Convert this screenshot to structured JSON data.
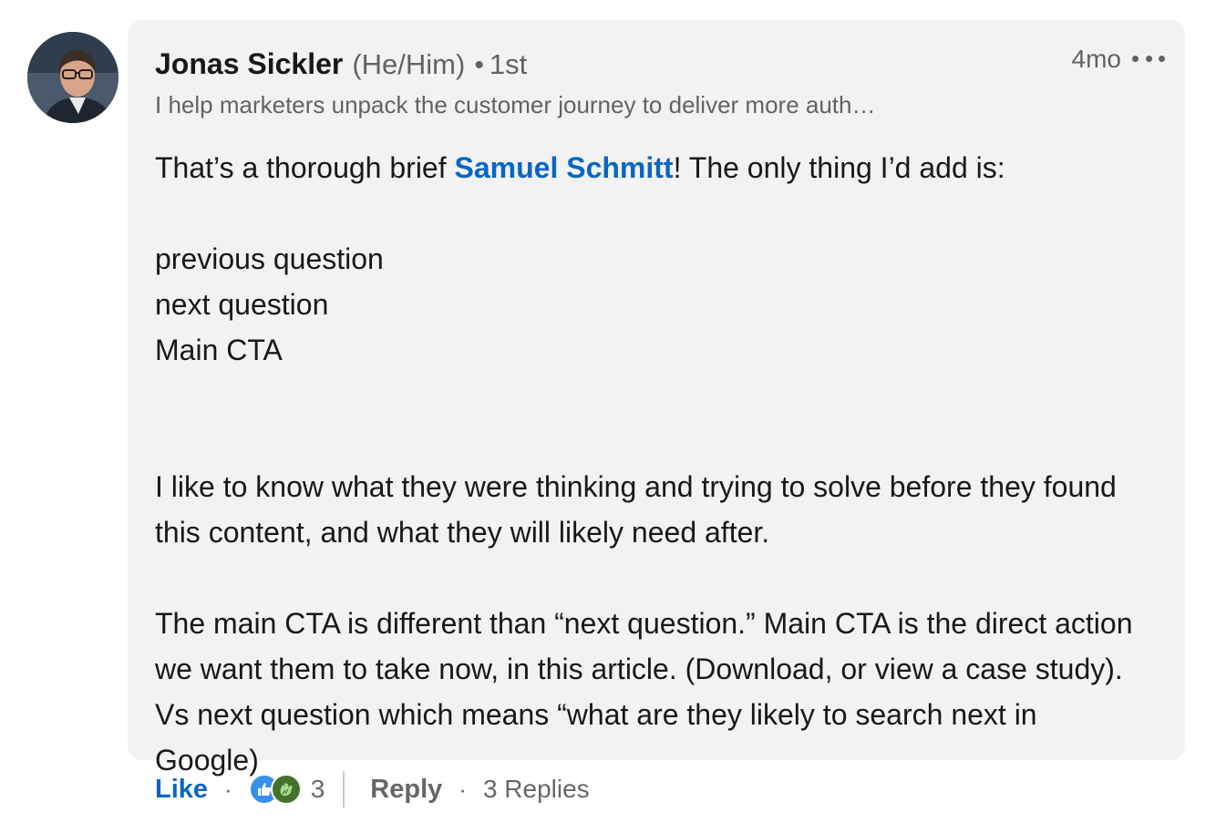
{
  "comment": {
    "author": {
      "name": "Jonas Sickler",
      "pronouns": "(He/Him)",
      "separator": "•",
      "degree": "1st",
      "headline": "I help marketers unpack the customer journey to deliver more auth…"
    },
    "timestamp": "4mo",
    "avatar_icon": "person-portrait",
    "more_icon": "ellipsis-horizontal-icon",
    "body": {
      "intro_before": "That’s a thorough brief ",
      "mention": "Samuel Schmitt",
      "intro_after": "! The only thing I’d add is:",
      "list": [
        "previous question",
        "next question",
        "Main CTA"
      ],
      "paragraph_1": "I like to know what they were thinking and trying to solve before they found this content, and what they will likely need after.",
      "paragraph_2": "The main CTA is different than “next question.” Main CTA is the direct action we want them to take now, in this article. (Download, or view a case study). Vs next question which means “what are they likely to search next in Google)"
    },
    "actions": {
      "like_label": "Like",
      "dot": "·",
      "reactions": [
        "like-reaction-icon",
        "celebrate-reaction-icon"
      ],
      "reaction_count": "3",
      "reply_label": "Reply",
      "replies_label": "3 Replies"
    },
    "colors": {
      "link": "#0a66c2",
      "bubble_bg": "#f2f2f2",
      "like_reaction": "#378fe9",
      "celebrate_reaction": "#44712e"
    }
  }
}
